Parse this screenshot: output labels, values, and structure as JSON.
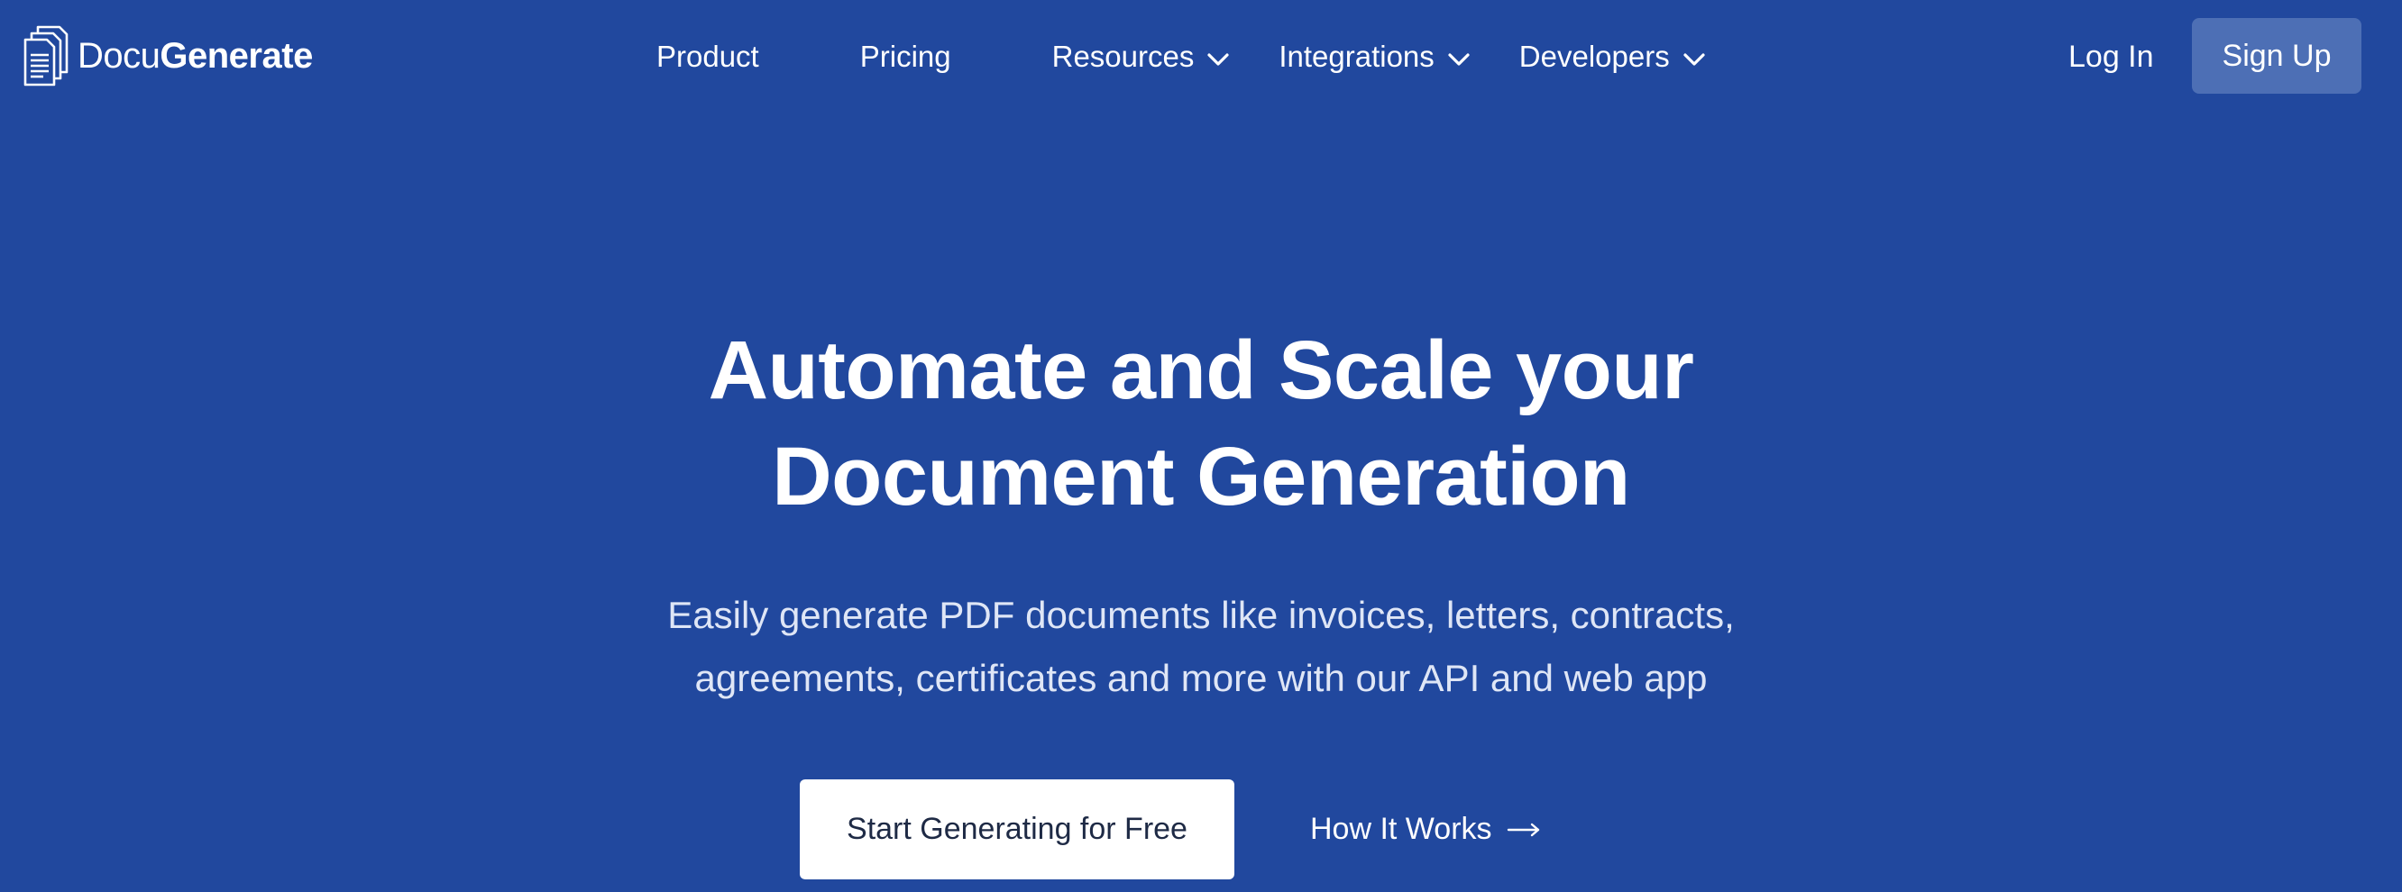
{
  "brand": {
    "name_light": "Docu",
    "name_bold": "Generate",
    "icon": "document-stack-icon"
  },
  "nav": {
    "items": [
      {
        "label": "Product",
        "has_dropdown": false
      },
      {
        "label": "Pricing",
        "has_dropdown": false
      },
      {
        "label": "Resources",
        "has_dropdown": true
      },
      {
        "label": "Integrations",
        "has_dropdown": true
      },
      {
        "label": "Developers",
        "has_dropdown": true
      }
    ],
    "login_label": "Log In",
    "signup_label": "Sign Up"
  },
  "hero": {
    "title_line1": "Automate and Scale your",
    "title_line2": "Document Generation",
    "subtitle_line1": "Easily generate PDF documents like invoices, letters, contracts,",
    "subtitle_line2": "agreements, certificates and more with our API and web app",
    "cta_primary": "Start Generating for Free",
    "cta_secondary": "How It Works",
    "cta_secondary_icon": "arrow-right-icon"
  },
  "colors": {
    "background": "#21489e",
    "signup_button": "#4d6fb5",
    "primary_button": "#ffffff",
    "primary_button_text": "#1e2a45",
    "subtitle_text": "#dfe6f6"
  }
}
